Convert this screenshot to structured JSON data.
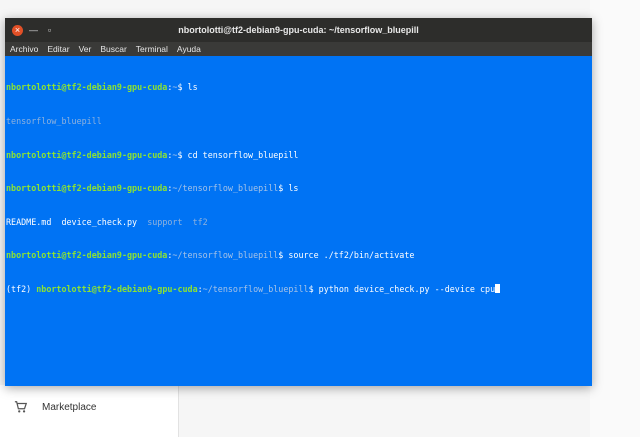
{
  "background": {
    "marketplace_label": "Marketplace"
  },
  "window": {
    "title": "nbortolotti@tf2-debian9-gpu-cuda: ~/tensorflow_bluepill",
    "close_glyph": "×",
    "minimize_glyph": "—",
    "maximize_glyph": "▫"
  },
  "menu": [
    "Archivo",
    "Editar",
    "Ver",
    "Buscar",
    "Terminal",
    "Ayuda"
  ],
  "terminal": {
    "lines": [
      {
        "user": "nbortolotti@tf2-debian9-gpu-cuda",
        "sep": ":",
        "path": "~",
        "cmd": "$ ls"
      },
      {
        "dim": "tensorflow_bluepill"
      },
      {
        "user": "nbortolotti@tf2-debian9-gpu-cuda",
        "sep": ":",
        "path": "~",
        "cmd": "$ cd tensorflow_bluepill"
      },
      {
        "user": "nbortolotti@tf2-debian9-gpu-cuda",
        "sep": ":",
        "path": "~/tensorflow_bluepill",
        "cmd": "$ ls"
      },
      {
        "out": "README.md  device_check.py  ",
        "dim": "support  tf2"
      },
      {
        "user": "nbortolotti@tf2-debian9-gpu-cuda",
        "sep": ":",
        "path": "~/tensorflow_bluepill",
        "cmd": "$ source ./tf2/bin/activate"
      },
      {
        "prefix": "(tf2) ",
        "user": "nbortolotti@tf2-debian9-gpu-cuda",
        "sep": ":",
        "path": "~/tensorflow_bluepill",
        "cmd": "$ python device_check.py --device cpu",
        "cursor": true
      }
    ]
  },
  "colors": {
    "terminal_bg": "#0073f4",
    "user_green": "#8ae234",
    "titlebar": "#2d2d2b"
  }
}
